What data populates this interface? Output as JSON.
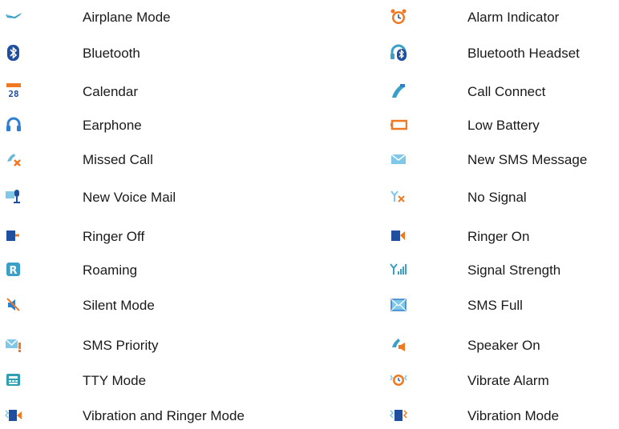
{
  "colors": {
    "icon_blue": "#2f7fd0",
    "icon_dark_blue": "#1f4f9e",
    "icon_orange": "#f07820",
    "icon_teal": "#3aa0c8"
  },
  "left": [
    {
      "icon": "airplane-mode-icon",
      "label": "Airplane Mode"
    },
    {
      "icon": "bluetooth-icon",
      "label": "Bluetooth"
    },
    {
      "icon": "calendar-icon",
      "label": "Calendar"
    },
    {
      "icon": "earphone-icon",
      "label": "Earphone"
    },
    {
      "icon": "missed-call-icon",
      "label": "Missed Call"
    },
    {
      "icon": "new-voice-mail-icon",
      "label": "New Voice Mail"
    },
    {
      "icon": "ringer-off-icon",
      "label": "Ringer Off"
    },
    {
      "icon": "roaming-icon",
      "label": "Roaming"
    },
    {
      "icon": "silent-mode-icon",
      "label": "Silent Mode"
    },
    {
      "icon": "sms-priority-icon",
      "label": "SMS Priority"
    },
    {
      "icon": "tty-mode-icon",
      "label": "TTY Mode"
    },
    {
      "icon": "vibration-and-ringer-mode-icon",
      "label": "Vibration and Ringer Mode"
    }
  ],
  "right": [
    {
      "icon": "alarm-indicator-icon",
      "label": "Alarm Indicator"
    },
    {
      "icon": "bluetooth-headset-icon",
      "label": "Bluetooth Headset"
    },
    {
      "icon": "call-connect-icon",
      "label": "Call Connect"
    },
    {
      "icon": "low-battery-icon",
      "label": "Low Battery"
    },
    {
      "icon": "new-sms-message-icon",
      "label": "New SMS Message"
    },
    {
      "icon": "no-signal-icon",
      "label": "No Signal"
    },
    {
      "icon": "ringer-on-icon",
      "label": "Ringer On"
    },
    {
      "icon": "signal-strength-icon",
      "label": "Signal Strength"
    },
    {
      "icon": "sms-full-icon",
      "label": "SMS Full"
    },
    {
      "icon": "speaker-on-icon",
      "label": "Speaker On"
    },
    {
      "icon": "vibrate-alarm-icon",
      "label": "Vibrate Alarm"
    },
    {
      "icon": "vibration-mode-icon",
      "label": "Vibration Mode"
    }
  ],
  "calendar_icon_text": "28"
}
